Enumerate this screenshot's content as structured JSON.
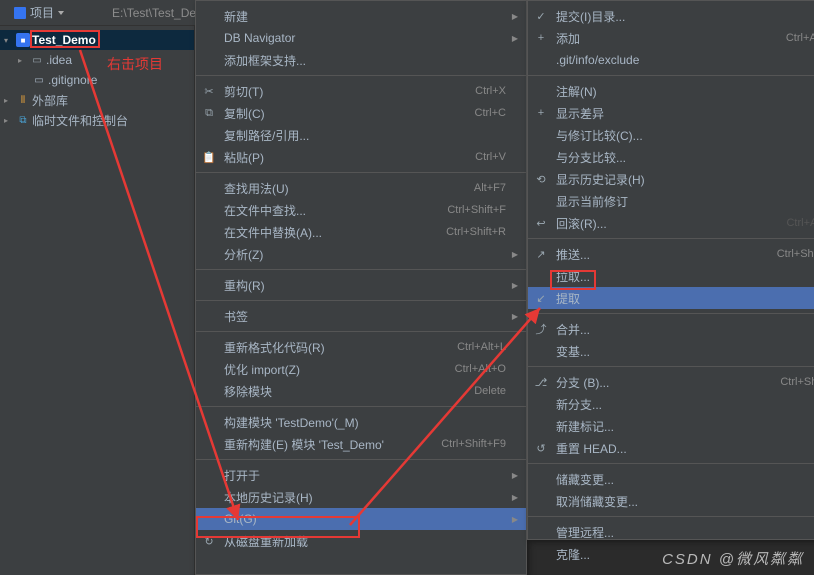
{
  "topbar": {
    "project_tab": "项目",
    "path": "E:\\Test\\Test_De"
  },
  "toolbar_icons": [
    "target",
    "down",
    "up",
    "gear",
    "minus"
  ],
  "tree": {
    "root": "Test_Demo",
    "idea": ".idea",
    "gitignore": ".gitignore",
    "ext_lib": "外部库",
    "console": "临时文件和控制台"
  },
  "annotation": "右击项目",
  "menu1": [
    {
      "t": "item",
      "label": "新建",
      "sub": true
    },
    {
      "t": "item",
      "label": "DB Navigator",
      "sub": true
    },
    {
      "t": "item",
      "label": "添加框架支持..."
    },
    {
      "t": "sep"
    },
    {
      "t": "item",
      "icon": "✂",
      "label": "剪切(T)",
      "sc": "Ctrl+X"
    },
    {
      "t": "item",
      "icon": "⧉",
      "label": "复制(C)",
      "sc": "Ctrl+C"
    },
    {
      "t": "item",
      "label": "复制路径/引用...",
      "sub": false
    },
    {
      "t": "item",
      "icon": "📋",
      "label": "粘贴(P)",
      "sc": "Ctrl+V"
    },
    {
      "t": "sep"
    },
    {
      "t": "item",
      "label": "查找用法(U)",
      "sc": "Alt+F7"
    },
    {
      "t": "item",
      "label": "在文件中查找...",
      "sc": "Ctrl+Shift+F"
    },
    {
      "t": "item",
      "label": "在文件中替换(A)...",
      "sc": "Ctrl+Shift+R"
    },
    {
      "t": "item",
      "label": "分析(Z)",
      "sub": true
    },
    {
      "t": "sep"
    },
    {
      "t": "item",
      "label": "重构(R)",
      "sub": true
    },
    {
      "t": "sep"
    },
    {
      "t": "item",
      "label": "书签",
      "sub": true
    },
    {
      "t": "sep"
    },
    {
      "t": "item",
      "label": "重新格式化代码(R)",
      "sc": "Ctrl+Alt+L"
    },
    {
      "t": "item",
      "label": "优化 import(Z)",
      "sc": "Ctrl+Alt+O"
    },
    {
      "t": "item",
      "label": "移除模块",
      "sc": "Delete"
    },
    {
      "t": "sep"
    },
    {
      "t": "item",
      "label": "构建模块 'TestDemo'(_M)"
    },
    {
      "t": "item",
      "label": "重新构建(E) 模块 'Test_Demo'",
      "sc": "Ctrl+Shift+F9"
    },
    {
      "t": "sep"
    },
    {
      "t": "item",
      "label": "打开于",
      "sub": true
    },
    {
      "t": "item",
      "label": "本地历史记录(H)",
      "sub": true
    },
    {
      "t": "item",
      "label": "Git(G)",
      "sub": true,
      "hi": true
    },
    {
      "t": "item",
      "icon": "↻",
      "label": "从磁盘重新加载"
    }
  ],
  "menu2": [
    {
      "t": "item",
      "icon": "✓",
      "label": "提交(I)目录..."
    },
    {
      "t": "item",
      "icon": "+",
      "label": "添加",
      "sc": "Ctrl+Alt+A"
    },
    {
      "t": "item",
      "label": ".git/info/exclude"
    },
    {
      "t": "sep"
    },
    {
      "t": "item",
      "label": "注解(N)",
      "disabled": true
    },
    {
      "t": "item",
      "icon": "+",
      "label": "显示差异",
      "disabled": true
    },
    {
      "t": "item",
      "label": "与修订比较(C)..."
    },
    {
      "t": "item",
      "label": "与分支比较..."
    },
    {
      "t": "item",
      "icon": "⟲",
      "label": "显示历史记录(H)"
    },
    {
      "t": "item",
      "label": "显示当前修订",
      "disabled": true
    },
    {
      "t": "item",
      "icon": "↩",
      "label": "回滚(R)...",
      "sc": "Ctrl+Alt+Z",
      "disabled": true
    },
    {
      "t": "sep"
    },
    {
      "t": "item",
      "icon": "↗",
      "label": "推送...",
      "sc": "Ctrl+Shift+K"
    },
    {
      "t": "item",
      "label": "拉取..."
    },
    {
      "t": "item",
      "icon": "↙",
      "label": "提取",
      "hi": true
    },
    {
      "t": "sep"
    },
    {
      "t": "item",
      "icon": "⤴",
      "label": "合并..."
    },
    {
      "t": "item",
      "label": "变基..."
    },
    {
      "t": "sep"
    },
    {
      "t": "item",
      "icon": "⎇",
      "label": "分支  (B)...",
      "sc": "Ctrl+Shift+`"
    },
    {
      "t": "item",
      "label": "新分支..."
    },
    {
      "t": "item",
      "label": "新建标记..."
    },
    {
      "t": "item",
      "icon": "↺",
      "label": "重置 HEAD..."
    },
    {
      "t": "sep"
    },
    {
      "t": "item",
      "label": "储藏变更..."
    },
    {
      "t": "item",
      "label": "取消储藏变更..."
    },
    {
      "t": "sep"
    },
    {
      "t": "item",
      "label": "管理远程..."
    },
    {
      "t": "item",
      "label": "克隆..."
    }
  ],
  "watermark": "CSDN @微风粼粼"
}
